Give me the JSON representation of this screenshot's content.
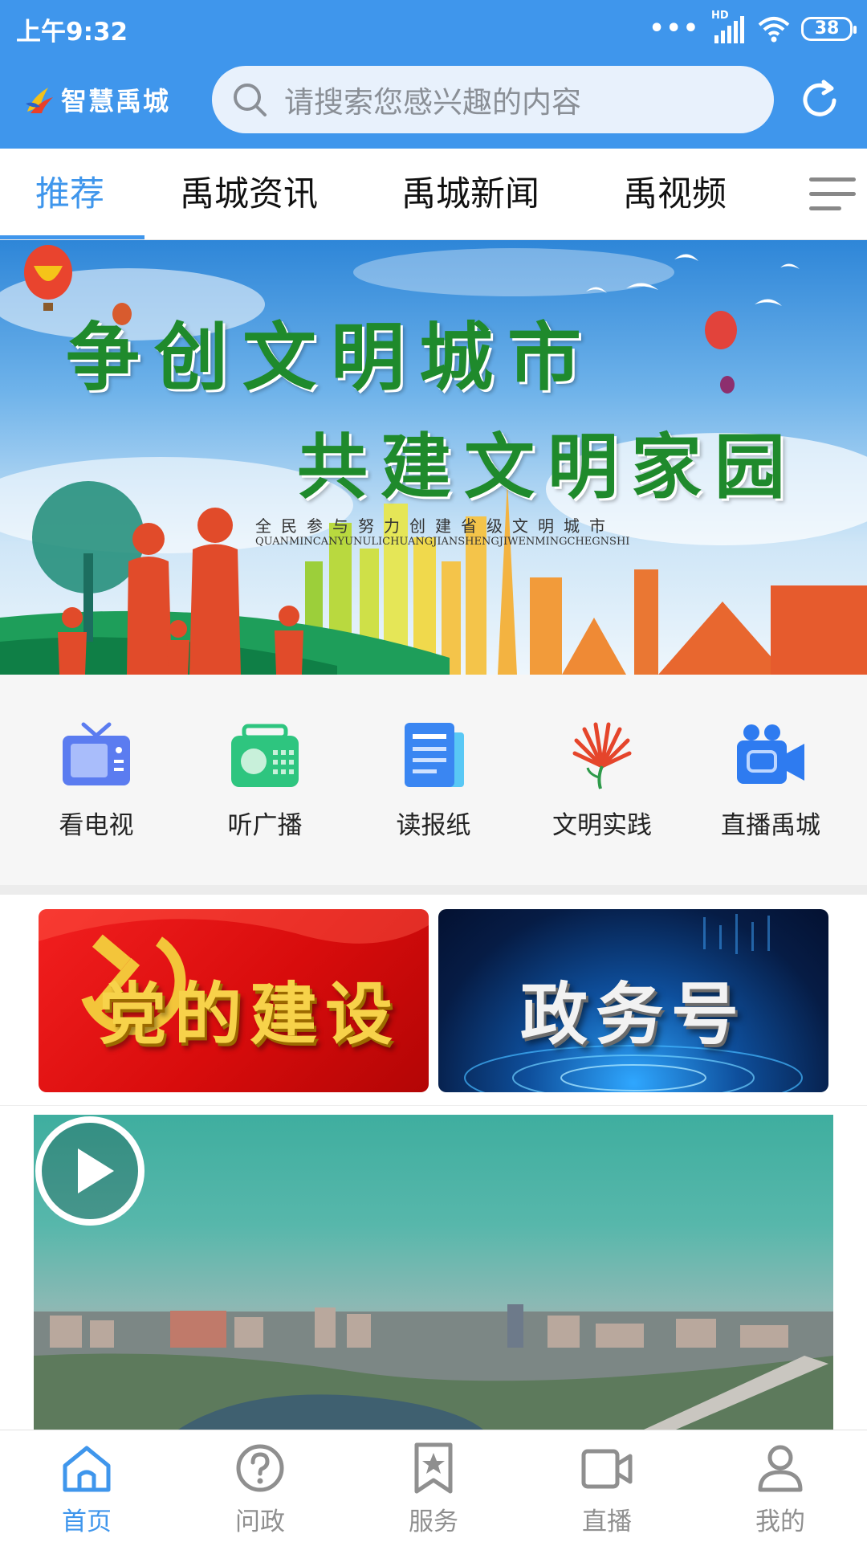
{
  "status_bar": {
    "time": "上午9:32",
    "dots": "•••",
    "network": "HD",
    "battery": "38"
  },
  "header": {
    "logo_text": "智慧禹城",
    "search_placeholder": "请搜索您感兴趣的内容"
  },
  "tabs": [
    {
      "label": "推荐",
      "active": true
    },
    {
      "label": "禹城资讯",
      "active": false
    },
    {
      "label": "禹城新闻",
      "active": false
    },
    {
      "label": "禹视频",
      "active": false
    }
  ],
  "banner": {
    "title_line1": "争创文明城市",
    "title_line2": "共建文明家园",
    "subtitle": "全民参与努力创建省级文明城市",
    "subtitle_pinyin": "QUANMINCANYUNULICHUANGJIANSHENGJIWENMINGCHEGNSHI"
  },
  "quick_entries": [
    {
      "label": "看电视",
      "icon": "tv-icon",
      "color": "#5b7cf0"
    },
    {
      "label": "听广播",
      "icon": "radio-icon",
      "color": "#2ec57f"
    },
    {
      "label": "读报纸",
      "icon": "newspaper-icon",
      "color": "#3a86f2"
    },
    {
      "label": "文明实践",
      "icon": "civilization-practice-icon",
      "color": "#e5452b"
    },
    {
      "label": "直播禹城",
      "icon": "live-camera-icon",
      "color": "#2e7bf0"
    }
  ],
  "promos": {
    "party_building": "党的建设",
    "government_account": "政务号"
  },
  "bottom_nav": [
    {
      "label": "首页",
      "icon": "home-icon",
      "active": true
    },
    {
      "label": "问政",
      "icon": "question-icon",
      "active": false
    },
    {
      "label": "服务",
      "icon": "service-star-icon",
      "active": false
    },
    {
      "label": "直播",
      "icon": "live-video-icon",
      "active": false
    },
    {
      "label": "我的",
      "icon": "user-icon",
      "active": false
    }
  ],
  "colors": {
    "accent": "#3f96ec",
    "inactive_nav": "#8f8f8f",
    "banner_text": "#1f8a2c"
  }
}
